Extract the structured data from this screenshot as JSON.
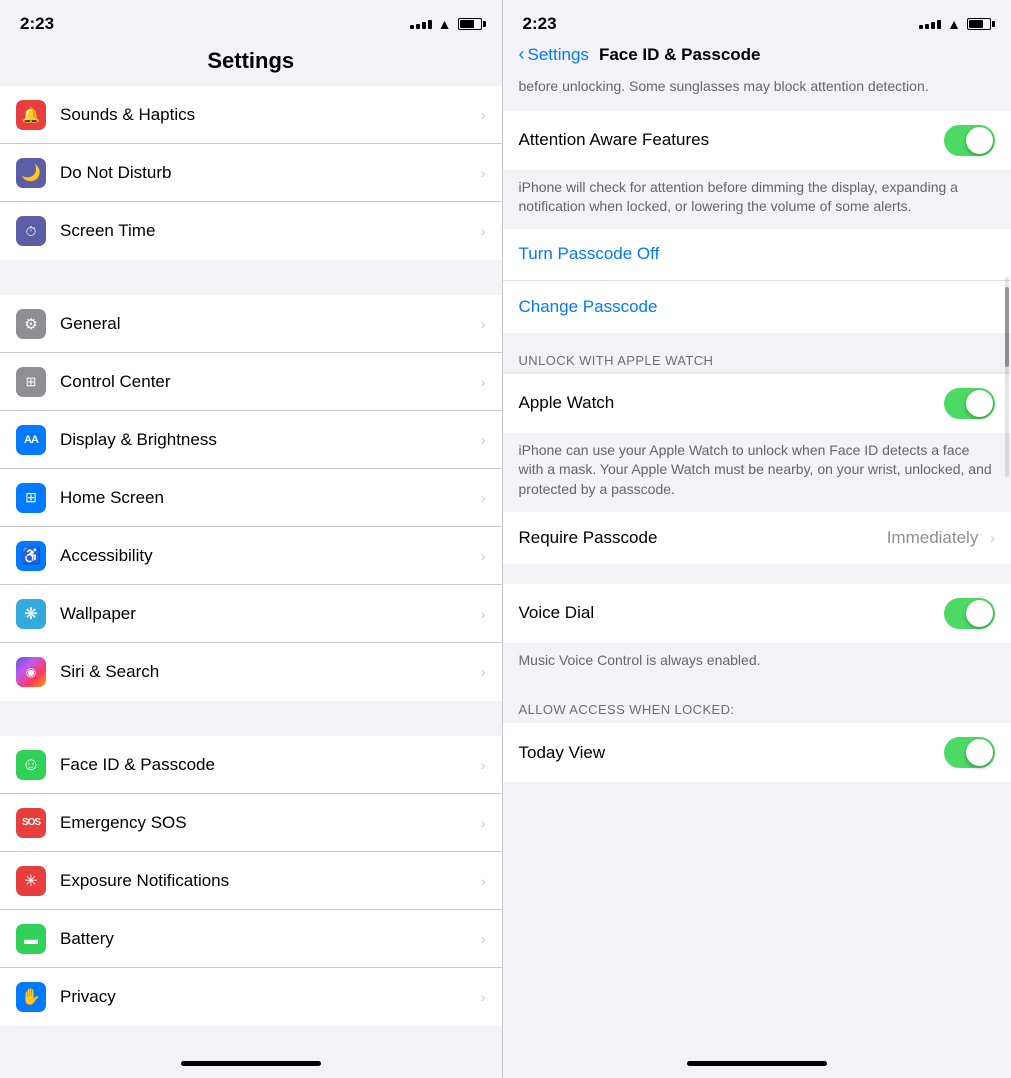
{
  "left": {
    "status": {
      "time": "2:23"
    },
    "title": "Settings",
    "items": [
      {
        "id": "sounds-haptics",
        "label": "Sounds & Haptics",
        "icon_bg": "#e83e3e",
        "icon": "🔔"
      },
      {
        "id": "do-not-disturb",
        "label": "Do Not Disturb",
        "icon_bg": "#5b5ea6",
        "icon": "🌙"
      },
      {
        "id": "screen-time",
        "label": "Screen Time",
        "icon_bg": "#5b5ea6",
        "icon": "⏱"
      },
      {
        "id": "general",
        "label": "General",
        "icon_bg": "#8e8e93",
        "icon": "⚙️"
      },
      {
        "id": "control-center",
        "label": "Control Center",
        "icon_bg": "#8e8e93",
        "icon": "⚙"
      },
      {
        "id": "display-brightness",
        "label": "Display & Brightness",
        "icon_bg": "#007aff",
        "icon": "AA"
      },
      {
        "id": "home-screen",
        "label": "Home Screen",
        "icon_bg": "#007aff",
        "icon": "⊞"
      },
      {
        "id": "accessibility",
        "label": "Accessibility",
        "icon_bg": "#007aff",
        "icon": "♿"
      },
      {
        "id": "wallpaper",
        "label": "Wallpaper",
        "icon_bg": "#34aadc",
        "icon": "❋"
      },
      {
        "id": "siri-search",
        "label": "Siri & Search",
        "icon_bg": "#5856d6",
        "icon": "◉"
      },
      {
        "id": "face-id",
        "label": "Face ID & Passcode",
        "icon_bg": "#30d158",
        "icon": "☺",
        "active": true
      },
      {
        "id": "emergency-sos",
        "label": "Emergency SOS",
        "icon_bg": "#e83e3e",
        "icon": "SOS"
      },
      {
        "id": "exposure-notifications",
        "label": "Exposure Notifications",
        "icon_bg": "#e83e3e",
        "icon": "✳"
      },
      {
        "id": "battery",
        "label": "Battery",
        "icon_bg": "#30d158",
        "icon": "▬"
      },
      {
        "id": "privacy",
        "label": "Privacy",
        "icon_bg": "#007aff",
        "icon": "✋"
      }
    ]
  },
  "right": {
    "status": {
      "time": "2:23"
    },
    "back_label": "Settings",
    "title": "Face ID & Passcode",
    "top_description": "before unlocking. Some sunglasses may block attention detection.",
    "attention_aware_label": "Attention Aware Features",
    "attention_aware_on": true,
    "attention_aware_description": "iPhone will check for attention before dimming the display, expanding a notification when locked, or lowering the volume of some alerts.",
    "turn_passcode_off": "Turn Passcode Off",
    "change_passcode": "Change Passcode",
    "unlock_with_watch_header": "UNLOCK WITH APPLE WATCH",
    "apple_watch_label": "Apple Watch",
    "apple_watch_on": true,
    "apple_watch_description": "iPhone can use your Apple Watch to unlock when Face ID detects a face with a mask. Your Apple Watch must be nearby, on your wrist, unlocked, and protected by a passcode.",
    "require_passcode_label": "Require Passcode",
    "require_passcode_value": "Immediately",
    "voice_dial_label": "Voice Dial",
    "voice_dial_on": true,
    "voice_dial_description": "Music Voice Control is always enabled.",
    "allow_access_header": "ALLOW ACCESS WHEN LOCKED:",
    "today_view_label": "Today View",
    "today_view_on": true
  }
}
